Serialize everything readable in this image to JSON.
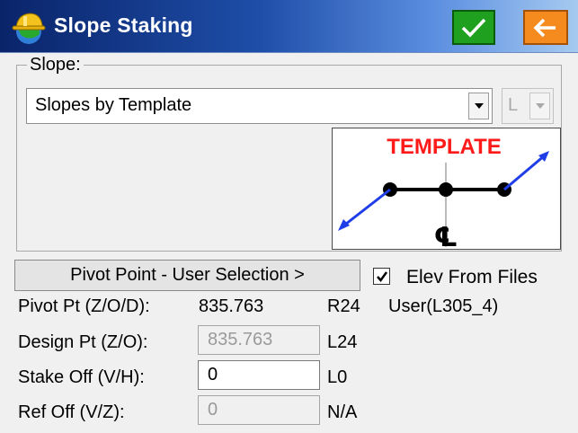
{
  "window": {
    "title": "Slope Staking",
    "app_icon": "helmet-globe-icon",
    "ok_icon": "checkmark-icon",
    "back_icon": "arrow-left-icon",
    "colors": {
      "title_bg": "#0a246a",
      "ok_bg": "#1fa01f",
      "back_bg": "#f58a1f"
    }
  },
  "slope_group": {
    "label": "Slope:",
    "method": {
      "selected": "Slopes by Template"
    },
    "side": {
      "selected": "L"
    },
    "template_image": {
      "title": "TEMPLATE",
      "centerline_symbol": "℄"
    }
  },
  "pivot": {
    "button_label": "Pivot Point - User Selection >",
    "elev_checkbox": {
      "label": "Elev From Files",
      "checked": true
    }
  },
  "rows": [
    {
      "label": "Pivot Pt (Z/O/D):",
      "value": "835.763",
      "suffix": "R24",
      "extra": "User(L305_4)"
    },
    {
      "label": "Design Pt (Z/O):",
      "value": "835.763",
      "suffix": "L24"
    },
    {
      "label": "Stake Off (V/H):",
      "value": "0",
      "suffix": "L0"
    },
    {
      "label": "Ref Off (V/Z):",
      "value": "0",
      "suffix": "N/A"
    }
  ]
}
